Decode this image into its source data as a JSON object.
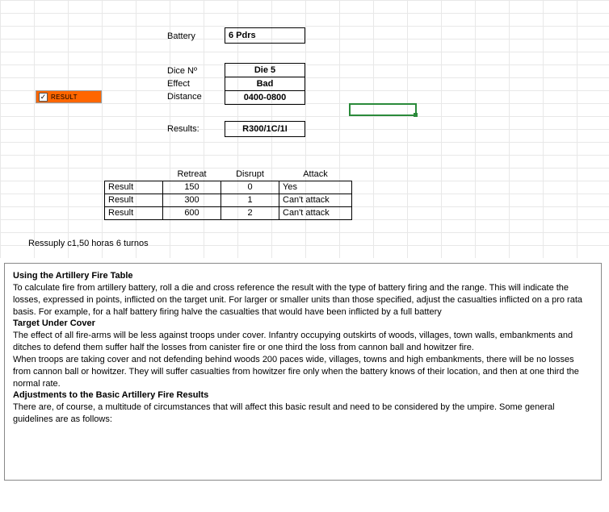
{
  "labels": {
    "battery": "Battery",
    "dice": "Dice Nº",
    "effect": "Effect",
    "distance": "Distance",
    "results": "Results:"
  },
  "values": {
    "battery": "6 Pdrs",
    "dice": "Die 5",
    "effect": "Bad",
    "distance": "0400-0800",
    "results": "R300/1C/1I"
  },
  "result_button": {
    "label": "RESULT",
    "checked": "✓"
  },
  "table": {
    "headers": [
      "",
      "Retreat",
      "Disrupt",
      "Attack"
    ],
    "rows": [
      {
        "label": "Result",
        "retreat": "150",
        "disrupt": "0",
        "attack": "Yes"
      },
      {
        "label": "Result",
        "retreat": "300",
        "disrupt": "1",
        "attack": "Can't attack"
      },
      {
        "label": "Result",
        "retreat": "600",
        "disrupt": "2",
        "attack": "Can't attack"
      }
    ]
  },
  "ressuply": "Ressuply c1,50 horas 6 turnos",
  "rules": {
    "h1": "Using the Artillery Fire Table",
    "p1": "To calculate fire from artillery battery, roll a die and cross reference the result with the type of battery firing and the range. This will indicate the losses, expressed in points, inflicted on the target unit. For larger or smaller units than those specified, adjust the casualties inflicted on a pro rata basis. For example, for a half battery firing halve the casualties that would have been inflicted by a full battery",
    "h2": "Target Under Cover",
    "p2": "The effect of all fire-arms will be less against troops under cover. Infantry occupying outskirts of woods, villages, town walls, embankments and ditches to defend them suffer half the losses from canister fire or one third the loss from cannon ball and howitzer fire.",
    "p3": "When troops are taking cover and not defending behind woods 200 paces wide, villages, towns and high embankments, there will be no losses from cannon ball or howitzer. They will suffer casualties from howitzer fire only when the battery knows of their location, and then at one third the normal rate.",
    "h3": "Adjustments to the Basic Artillery Fire Results",
    "p4": "There are, of course, a multitude of circumstances that will affect this basic result and need to be considered by the umpire. Some general guidelines are as follows:"
  }
}
